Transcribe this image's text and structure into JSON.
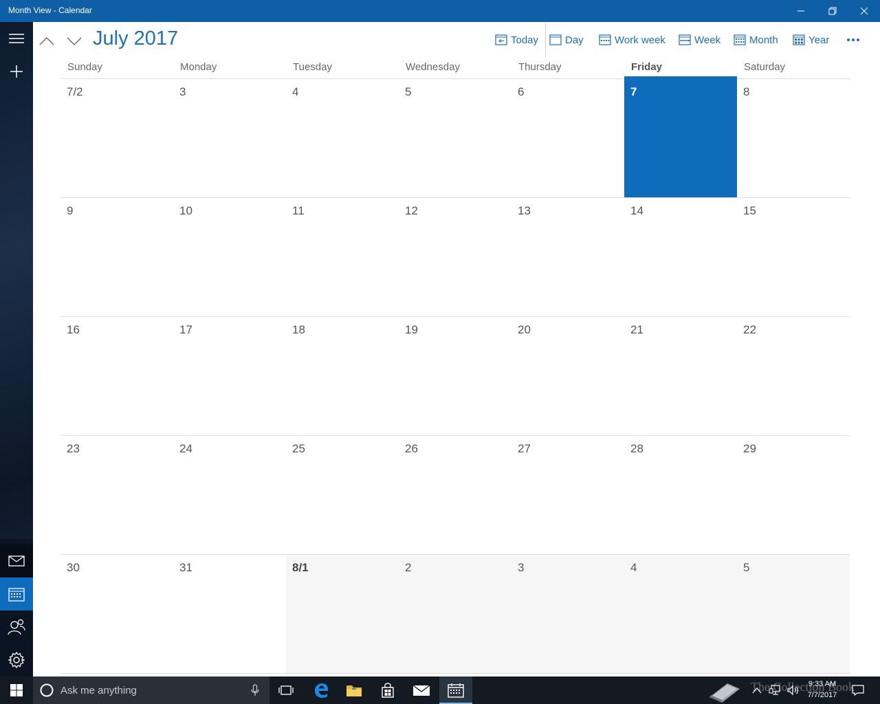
{
  "window": {
    "title": "Month View - Calendar"
  },
  "header": {
    "month_title": "July 2017",
    "views": [
      "Today",
      "Day",
      "Work week",
      "Week",
      "Month",
      "Year"
    ]
  },
  "calendar": {
    "weekdays": [
      "Sunday",
      "Monday",
      "Tuesday",
      "Wednesday",
      "Thursday",
      "Friday",
      "Saturday"
    ],
    "today_weekday_index": 5,
    "weeks": [
      [
        "7/2",
        "3",
        "4",
        "5",
        "6",
        "7",
        "8"
      ],
      [
        "9",
        "10",
        "11",
        "12",
        "13",
        "14",
        "15"
      ],
      [
        "16",
        "17",
        "18",
        "19",
        "20",
        "21",
        "22"
      ],
      [
        "23",
        "24",
        "25",
        "26",
        "27",
        "28",
        "29"
      ],
      [
        "30",
        "31",
        "8/1",
        "2",
        "3",
        "4",
        "5"
      ]
    ]
  },
  "taskbar": {
    "search_placeholder": "Ask me anything",
    "watermark": "The Collection Book",
    "time": "9:33 AM",
    "date": "7/7/2017"
  },
  "colors": {
    "accent": "#0f6cbd",
    "titlebar": "#0f5fa6",
    "link": "#1d6fb8"
  }
}
